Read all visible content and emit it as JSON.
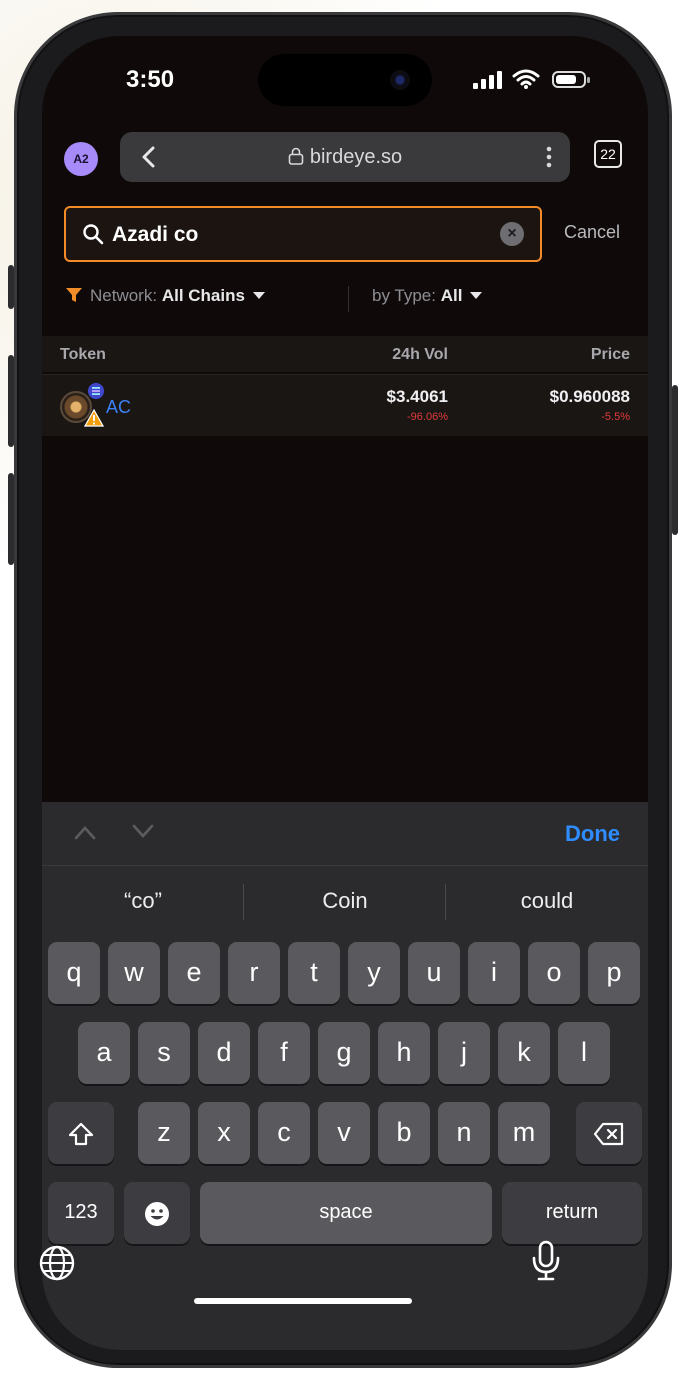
{
  "status_bar": {
    "time": "3:50"
  },
  "browser": {
    "avatar_label": "A2",
    "url": "birdeye.so",
    "tab_count": "22"
  },
  "search": {
    "query": "Azadi co",
    "cancel_label": "Cancel"
  },
  "filters": {
    "network_label": "Network:",
    "network_value": "All Chains",
    "type_label": "by Type:",
    "type_value": "All"
  },
  "table": {
    "headers": {
      "token": "Token",
      "volume": "24h Vol",
      "price": "Price"
    },
    "rows": [
      {
        "symbol": "AC",
        "volume": "$3.4061",
        "volume_change": "-96.06%",
        "price": "$0.960088",
        "price_change": "-5.5%"
      }
    ]
  },
  "keyboard": {
    "done_label": "Done",
    "suggestions": [
      "“co”",
      "Coin",
      "could"
    ],
    "row1": [
      "q",
      "w",
      "e",
      "r",
      "t",
      "y",
      "u",
      "i",
      "o",
      "p"
    ],
    "row2": [
      "a",
      "s",
      "d",
      "f",
      "g",
      "h",
      "j",
      "k",
      "l"
    ],
    "row3": [
      "z",
      "x",
      "c",
      "v",
      "b",
      "n",
      "m"
    ],
    "numbers_label": "123",
    "space_label": "space",
    "return_label": "return"
  },
  "colors": {
    "accent_orange": "#f28c28",
    "negative_red": "#e23b3b",
    "link_blue": "#3b82f6",
    "done_blue": "#2f8cff"
  }
}
